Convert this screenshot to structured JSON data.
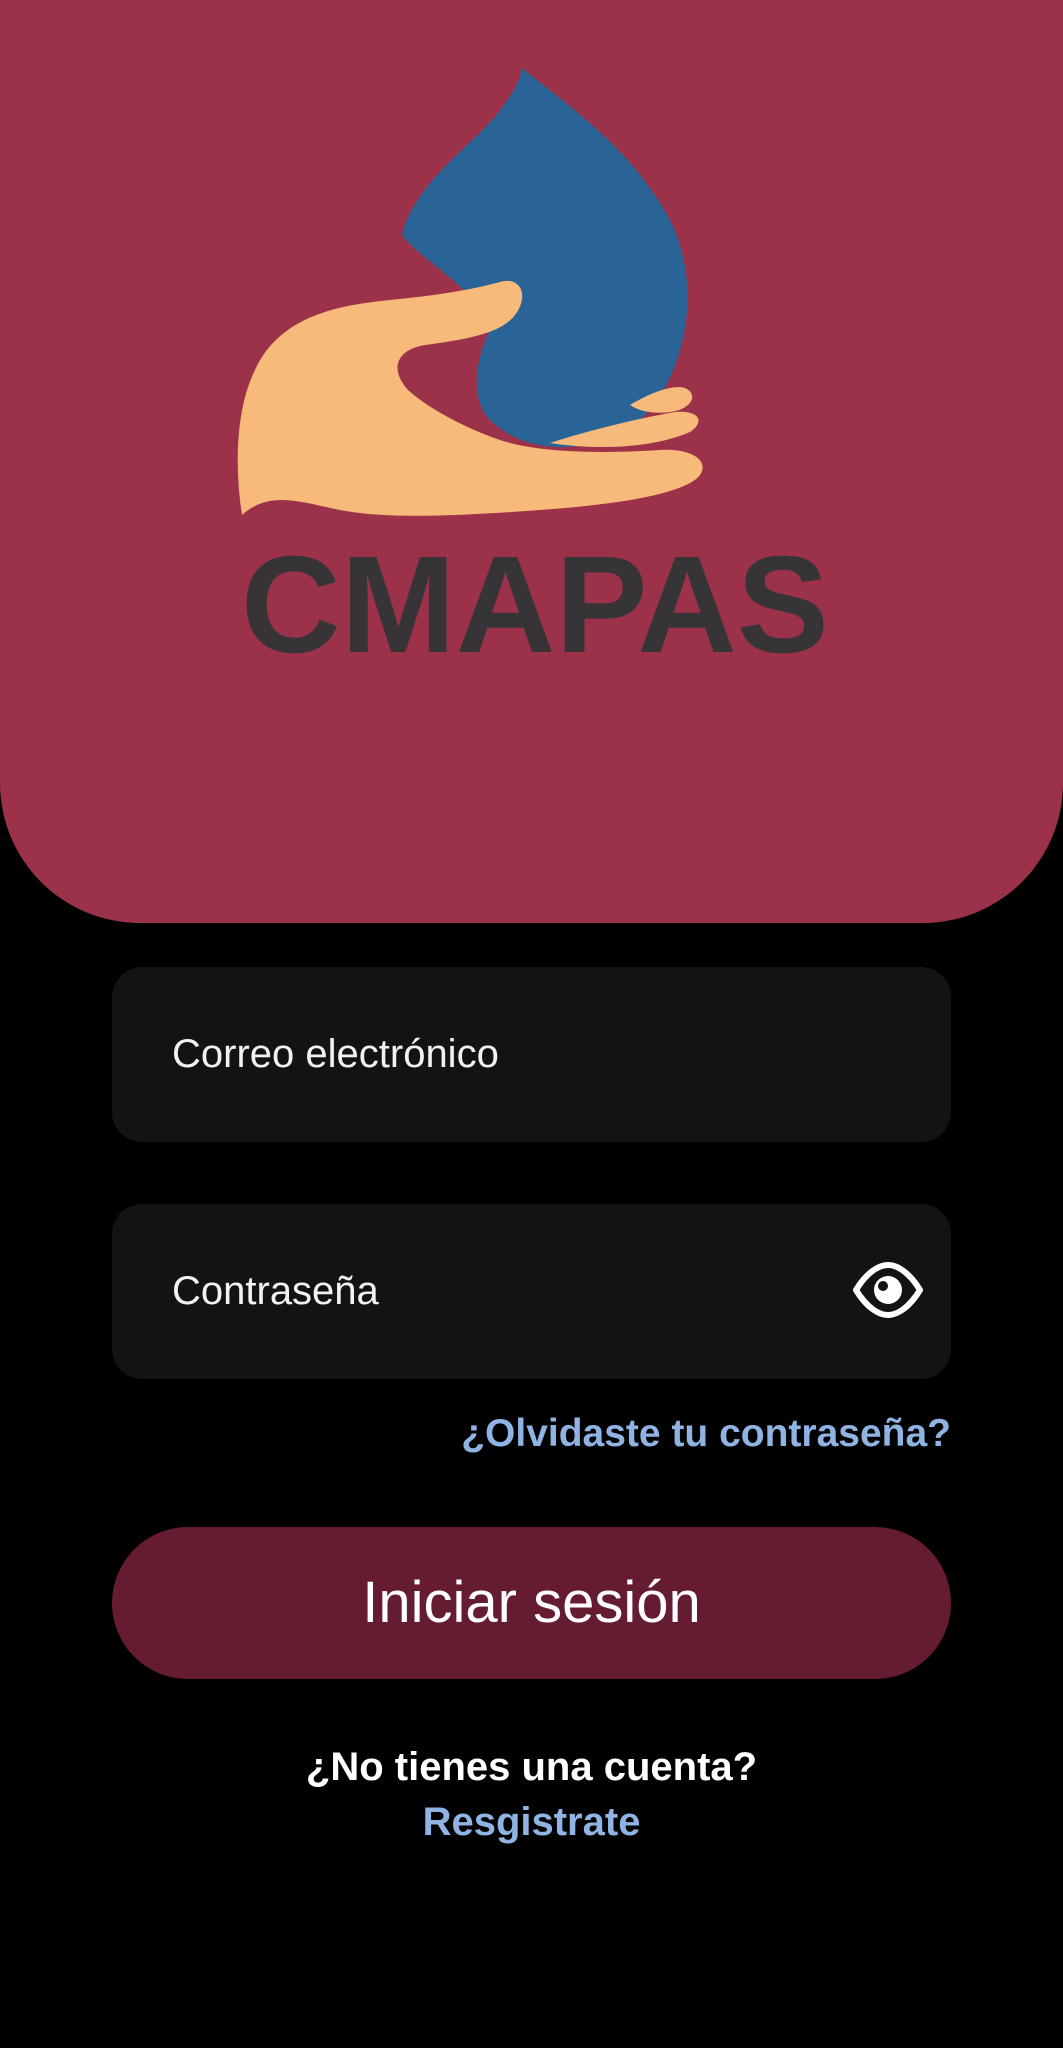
{
  "colors": {
    "header_background": "#9b3249",
    "page_background": "#000000",
    "field_background": "#131313",
    "button_background": "#661c30",
    "link": "#8fb4e3",
    "logo_drop": "#2a6496",
    "logo_hand": "#f8ba7a",
    "logo_text": "#363436"
  },
  "logo": {
    "text": "CMAPAS",
    "icon": "water-drop-hand-icon"
  },
  "form": {
    "email_placeholder": "Correo electrónico",
    "password_placeholder": "Contraseña",
    "show_password_icon": "eye-icon",
    "forgot_password": "¿Olvidaste tu contraseña?",
    "login_button": "Iniciar sesión"
  },
  "footer": {
    "no_account": "¿No tienes una cuenta?",
    "register": "Resgistrate"
  }
}
